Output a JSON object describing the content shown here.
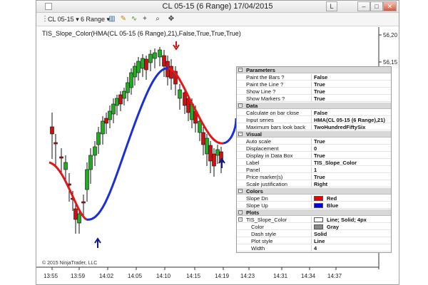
{
  "window": {
    "title": "CL 05-15 (6 Range)  17/04/2015",
    "layout_button": "L",
    "min_glyph": "–",
    "max_glyph": "□",
    "close_glyph": "✕"
  },
  "toolbar": {
    "instrument": "CL 05-15 ▾",
    "interval": "6 Range ▾"
  },
  "chart": {
    "indicator_label": "TIS_Slope_Color(HMA(CL 05-15 (6 Range),21),False,True,True,True)",
    "copyright": "© 2015 NinjaTrader, LLC",
    "price_labels": [
      "56,20",
      "56,15"
    ],
    "time_labels": [
      "13:55",
      "13:59",
      "14:02",
      "14:05",
      "14:10",
      "14:15",
      "14:19",
      "14:23",
      "14:31",
      "14:34",
      "14:37"
    ],
    "colors": {
      "up_candle": "#22aa22",
      "down_candle": "#cc1111",
      "slope_down": "#e11818",
      "slope_up": "#1a2fd8",
      "marker_down": "#cc1111",
      "marker_up": "#0a1a8a"
    }
  },
  "properties": [
    {
      "type": "cat",
      "name": "Parameters"
    },
    {
      "type": "row",
      "name": "Paint the Bars ?",
      "value": "False"
    },
    {
      "type": "row",
      "name": "Paint the Line ?",
      "value": "True"
    },
    {
      "type": "row",
      "name": "Show Line ?",
      "value": "True"
    },
    {
      "type": "row",
      "name": "Show Markers ?",
      "value": "True"
    },
    {
      "type": "cat",
      "name": "Data"
    },
    {
      "type": "row",
      "name": "Calculate on bar close",
      "value": "False"
    },
    {
      "type": "row",
      "name": "Input series",
      "value": "HMA(CL 05-15 (6 Range),21)"
    },
    {
      "type": "row",
      "name": "Maximum bars look back",
      "value": "TwoHundredFiftySix"
    },
    {
      "type": "cat",
      "name": "Visual"
    },
    {
      "type": "row",
      "name": "Auto scale",
      "value": "True"
    },
    {
      "type": "row",
      "name": "Displacement",
      "value": "0"
    },
    {
      "type": "row",
      "name": "Display in Data Box",
      "value": "True"
    },
    {
      "type": "row",
      "name": "Label",
      "value": "TIS_Slope_Color"
    },
    {
      "type": "row",
      "name": "Panel",
      "value": "1"
    },
    {
      "type": "row",
      "name": "Price marker(s)",
      "value": "True"
    },
    {
      "type": "row",
      "name": "Scale justification",
      "value": "Right"
    },
    {
      "type": "cat",
      "name": "Colors"
    },
    {
      "type": "color",
      "name": "Slope Dn",
      "value": "Red",
      "swatch": "#ee0000"
    },
    {
      "type": "color",
      "name": "Slope Up",
      "value": "Blue",
      "swatch": "#0000ee"
    },
    {
      "type": "cat",
      "name": "Plots"
    },
    {
      "type": "plot",
      "name": "TIS_Slope_Color",
      "value": "Line; Solid; 4px"
    },
    {
      "type": "color",
      "name": "Color",
      "value": "Gray",
      "swatch": "#888888",
      "sub": true
    },
    {
      "type": "row",
      "name": "Dash style",
      "value": "Solid",
      "sub": true
    },
    {
      "type": "row",
      "name": "Plot style",
      "value": "Line",
      "sub": true
    },
    {
      "type": "row",
      "name": "Width",
      "value": "4",
      "sub": true
    }
  ]
}
